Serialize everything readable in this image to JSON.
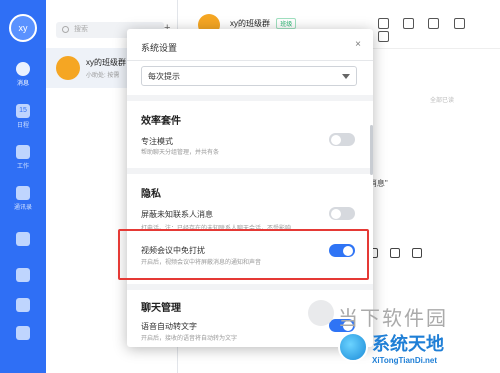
{
  "sidebar": {
    "avatar_text": "xy",
    "nav": [
      {
        "label": "消息",
        "icon": "chat-icon",
        "active": true
      },
      {
        "label": "日程",
        "icon": "calendar-icon",
        "badge": "15"
      },
      {
        "label": "工作",
        "icon": "apps-icon"
      },
      {
        "label": "通讯录",
        "icon": "contacts-icon"
      },
      {
        "label": "",
        "icon": "docs-icon"
      },
      {
        "label": "",
        "icon": "phone-icon"
      },
      {
        "label": "",
        "icon": "cloud-icon"
      },
      {
        "label": "",
        "icon": "mail-icon"
      }
    ]
  },
  "list": {
    "search_placeholder": "搜索",
    "conversation": {
      "name": "xy的班级群",
      "preview": "小助处: 按需"
    }
  },
  "chat": {
    "title": "xy的班级群",
    "tag": "班级",
    "read_status": "全部已读",
    "quoted": "\"消息\""
  },
  "dialog": {
    "title": "系统设置",
    "close": "×",
    "select_value": "每次提示",
    "sections": {
      "efficiency": "效率套件",
      "privacy": "隐私",
      "chat_mgmt": "聊天管理"
    },
    "options": {
      "focus": {
        "label": "专注模式",
        "desc": "帮助聊天分组管理，并共有条",
        "on": false
      },
      "block_unknown": {
        "label": "屏蔽未知联系人消息",
        "desc": "打电话。注：已经存在的未知联系人聊天会话，不受影响",
        "on": false
      },
      "meeting_dnd": {
        "label": "视频会议中免打扰",
        "desc": "开启后，视频会议中将屏蔽消息的通知和声音",
        "on": true
      },
      "voice_to_text": {
        "label": "语音自动转文字",
        "desc": "开启后，接收的语音将自动转为文字",
        "on": true
      }
    }
  },
  "watermark": {
    "top_text": "当下软件园",
    "bottom_big": "系统天地",
    "bottom_small": "XiTongTianDi.net"
  },
  "colors": {
    "accent": "#2f6ff5",
    "highlight": "#e53935"
  }
}
